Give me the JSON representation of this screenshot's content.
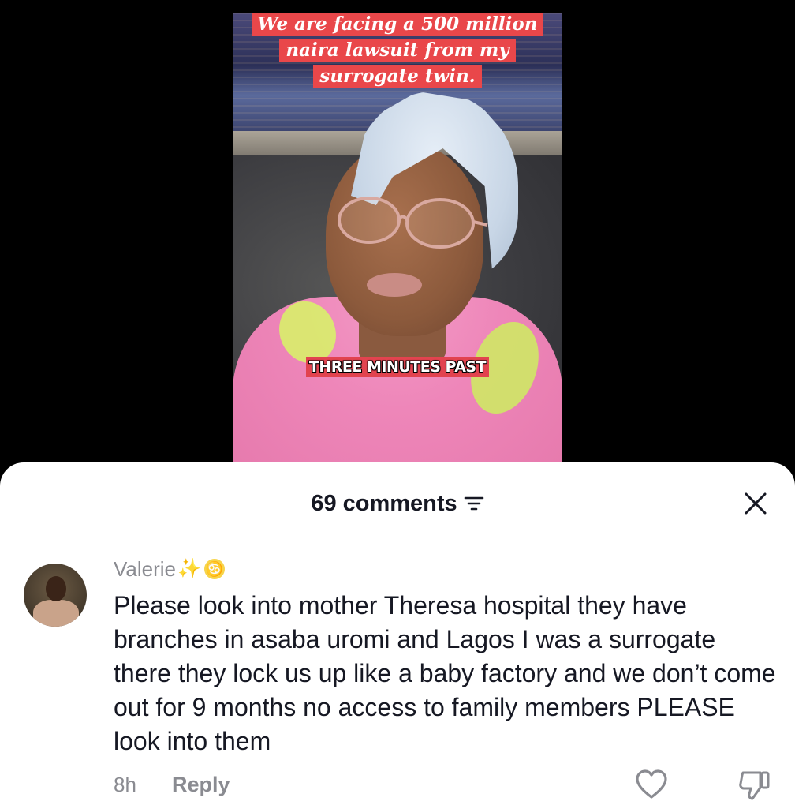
{
  "video": {
    "top_caption_lines": [
      "We are facing a 500 million",
      "naira lawsuit from my",
      "surrogate twin."
    ],
    "bottom_caption": "THREE MINUTES PAST"
  },
  "comments_panel": {
    "count_label": "69 comments",
    "sort_icon": "filter-lines-icon",
    "close_icon": "close-icon"
  },
  "comment": {
    "username": "Valerie",
    "username_badges": [
      "✨",
      "♋"
    ],
    "text": "Please look into mother Theresa hospital they have branches in asaba uromi and Lagos I was a surrogate there they lock us up like a baby factory and we don’t come out for 9 months no access to family members PLEASE look into them",
    "time": "8h",
    "reply_label": "Reply",
    "like_icon": "heart-outline-icon",
    "dislike_icon": "thumbs-down-icon"
  },
  "colors": {
    "caption_bg": "#e9474a",
    "text_primary": "#161823",
    "text_secondary": "#8a8b91"
  }
}
